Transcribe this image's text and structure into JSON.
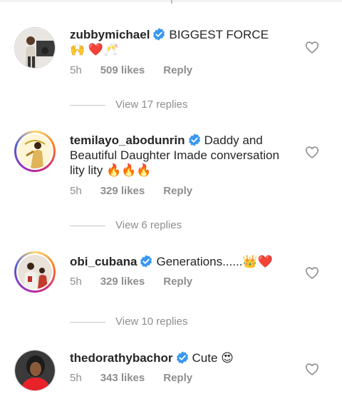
{
  "comments": [
    {
      "username": "zubbymichael",
      "text": "BIGGEST FORCE 🙌 ❤️🥂",
      "time": "5h",
      "likes": "509 likes",
      "reply_label": "Reply",
      "view_replies": "View 17 replies"
    },
    {
      "username": "temilayo_abodunrin",
      "text": "Daddy and Beautiful Daughter Imade conversation lity lity 🔥🔥🔥",
      "time": "5h",
      "likes": "329 likes",
      "reply_label": "Reply",
      "view_replies": "View 6 replies"
    },
    {
      "username": "obi_cubana",
      "text": "Generations......👑❤️",
      "time": "5h",
      "likes": "329 likes",
      "reply_label": "Reply",
      "view_replies": "View 10 replies"
    },
    {
      "username": "thedorathybachor",
      "text": "Cute 😍",
      "time": "5h",
      "likes": "343 likes",
      "reply_label": "Reply"
    }
  ],
  "colors": {
    "verified_blue": "#3897f0",
    "secondary_text": "#8e8e8e",
    "primary_text": "#262626"
  },
  "icons": [
    "verified-badge-icon",
    "heart-icon"
  ]
}
